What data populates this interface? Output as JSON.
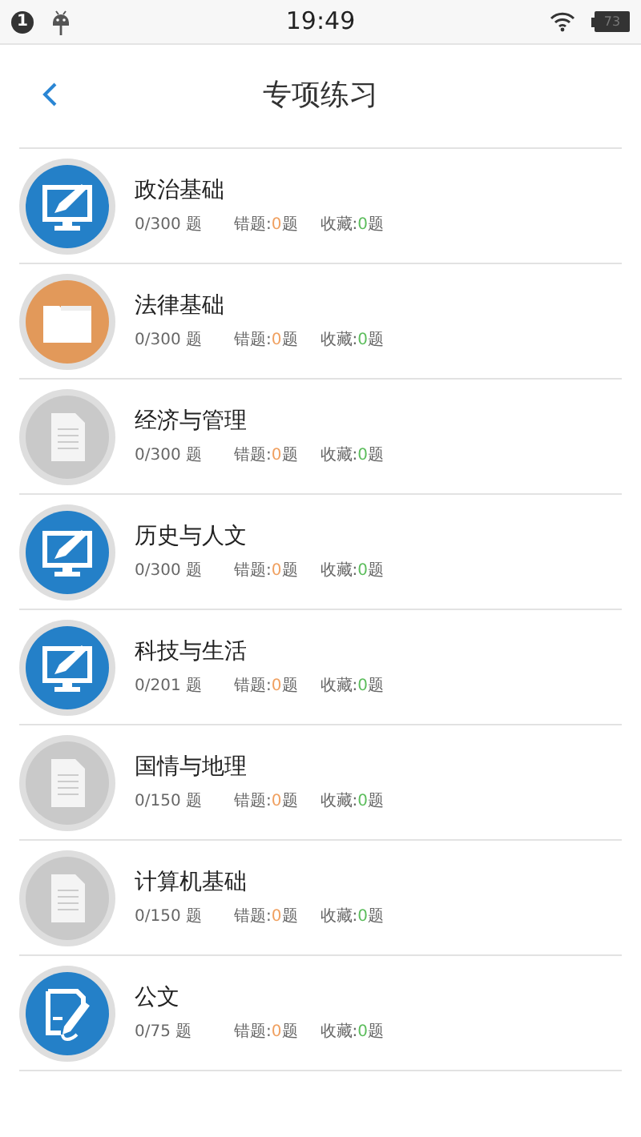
{
  "status_bar": {
    "notification_count": "1",
    "time": "19:49",
    "battery": "73"
  },
  "header": {
    "title": "专项练习"
  },
  "items": [
    {
      "kind": "monitor",
      "title": "政治基础",
      "progress": "0/300 题",
      "wrong": {
        "label": "错题:",
        "count": "0",
        "unit": "题"
      },
      "saved": {
        "label": "收藏:",
        "count": "0",
        "unit": "题"
      }
    },
    {
      "kind": "folder",
      "title": "法律基础",
      "progress": "0/300 题",
      "wrong": {
        "label": "错题:",
        "count": "0",
        "unit": "题"
      },
      "saved": {
        "label": "收藏:",
        "count": "0",
        "unit": "题"
      }
    },
    {
      "kind": "document",
      "title": "经济与管理",
      "progress": "0/300 题",
      "wrong": {
        "label": "错题:",
        "count": "0",
        "unit": "题"
      },
      "saved": {
        "label": "收藏:",
        "count": "0",
        "unit": "题"
      }
    },
    {
      "kind": "monitor",
      "title": "历史与人文",
      "progress": "0/300 题",
      "wrong": {
        "label": "错题:",
        "count": "0",
        "unit": "题"
      },
      "saved": {
        "label": "收藏:",
        "count": "0",
        "unit": "题"
      }
    },
    {
      "kind": "monitor",
      "title": "科技与生活",
      "progress": "0/201 题",
      "wrong": {
        "label": "错题:",
        "count": "0",
        "unit": "题"
      },
      "saved": {
        "label": "收藏:",
        "count": "0",
        "unit": "题"
      }
    },
    {
      "kind": "document",
      "title": "国情与地理",
      "progress": "0/150 题",
      "wrong": {
        "label": "错题:",
        "count": "0",
        "unit": "题"
      },
      "saved": {
        "label": "收藏:",
        "count": "0",
        "unit": "题"
      }
    },
    {
      "kind": "document",
      "title": "计算机基础",
      "progress": "0/150 题",
      "wrong": {
        "label": "错题:",
        "count": "0",
        "unit": "题"
      },
      "saved": {
        "label": "收藏:",
        "count": "0",
        "unit": "题"
      }
    },
    {
      "kind": "edit",
      "title": "公文",
      "progress": "0/75 题",
      "wrong": {
        "label": "错题:",
        "count": "0",
        "unit": "题"
      },
      "saved": {
        "label": "收藏:",
        "count": "0",
        "unit": "题"
      }
    }
  ]
}
